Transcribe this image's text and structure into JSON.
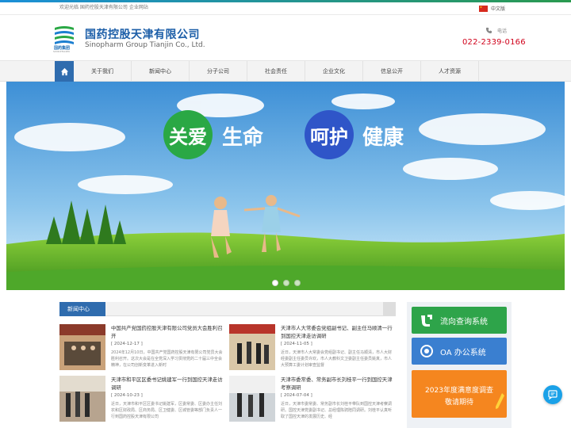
{
  "topbar": {
    "welcome": "欢迎光临 国药控股天津有限公司 企业网站",
    "language": "中文版"
  },
  "header": {
    "logo_text": "国药集团",
    "logo_sub": "SINOPHARM",
    "company_cn": "国药控股天津有限公司",
    "company_en": "Sinopharm Group Tianjin Co., Ltd.",
    "phone_label": "电话",
    "phone_number": "022-2339-0166"
  },
  "nav": {
    "home_icon": "home-icon",
    "items": [
      "关于我们",
      "新闻中心",
      "分子公司",
      "社会责任",
      "企业文化",
      "信息公开",
      "人才资源"
    ]
  },
  "banner": {
    "circle1": "关爱",
    "word1": "生命",
    "circle2": "呵护",
    "word2": "健康",
    "circle1_color": "#2aa845",
    "circle2_color": "#2f55c8",
    "slides": 3,
    "active_slide": 1
  },
  "news": {
    "tab": "新闻中心",
    "items": [
      {
        "title": "中国共产党国药控股天津有限公司党员大会胜利召开",
        "date": "[ 2024-12-17 ]",
        "desc": "2024年12月10日，中国共产党国药控股天津有限公司党员大会胜利召开。这次大会是在全党深入学习贯彻党的二十届三中全会精神，在公司创新变革进入新时"
      },
      {
        "title": "天津市人大常委会党组副书记、副主任马顺清一行到国控天津走访调研",
        "date": "[ 2024-11-05 ]",
        "desc": "近日，天津市人大常委会党组副书记、副主任马顺清，市人大财经委副主任委员许欢，市人大教科文卫委副主任委员姚真，市人大预算工委计划审查监督"
      },
      {
        "title": "天津市和平区区委书记姚建军一行到国控天津走访调研",
        "date": "[ 2024-10-23 ]",
        "desc": "近日，天津市和平区区委书记姚建军，区委常委、区委办主任刘农和区财政局、区商务局、区卫健委、区城管委等部门负责人一行到国药控股天津有限公司"
      },
      {
        "title": "天津市委常委、常务副市长刘桂平一行到国控天津考察调研",
        "date": "[ 2024-07-04 ]",
        "desc": "近日，天津市委常委、常务副市长刘桂平带队到国控天津考察调研。国控天津党委副书记、总经理陈骋陪同调研。刘桂平认真听取了国控天津的发展历史、经"
      }
    ]
  },
  "side": {
    "btn1": "流向查询系统",
    "btn2": "OA 办公系统",
    "survey_l1": "2023年度满意度调查",
    "survey_l2": "敬请期待",
    "btn1_color": "#2ea44a",
    "btn2_color": "#3a7fd0",
    "survey_color": "#f5861f"
  }
}
